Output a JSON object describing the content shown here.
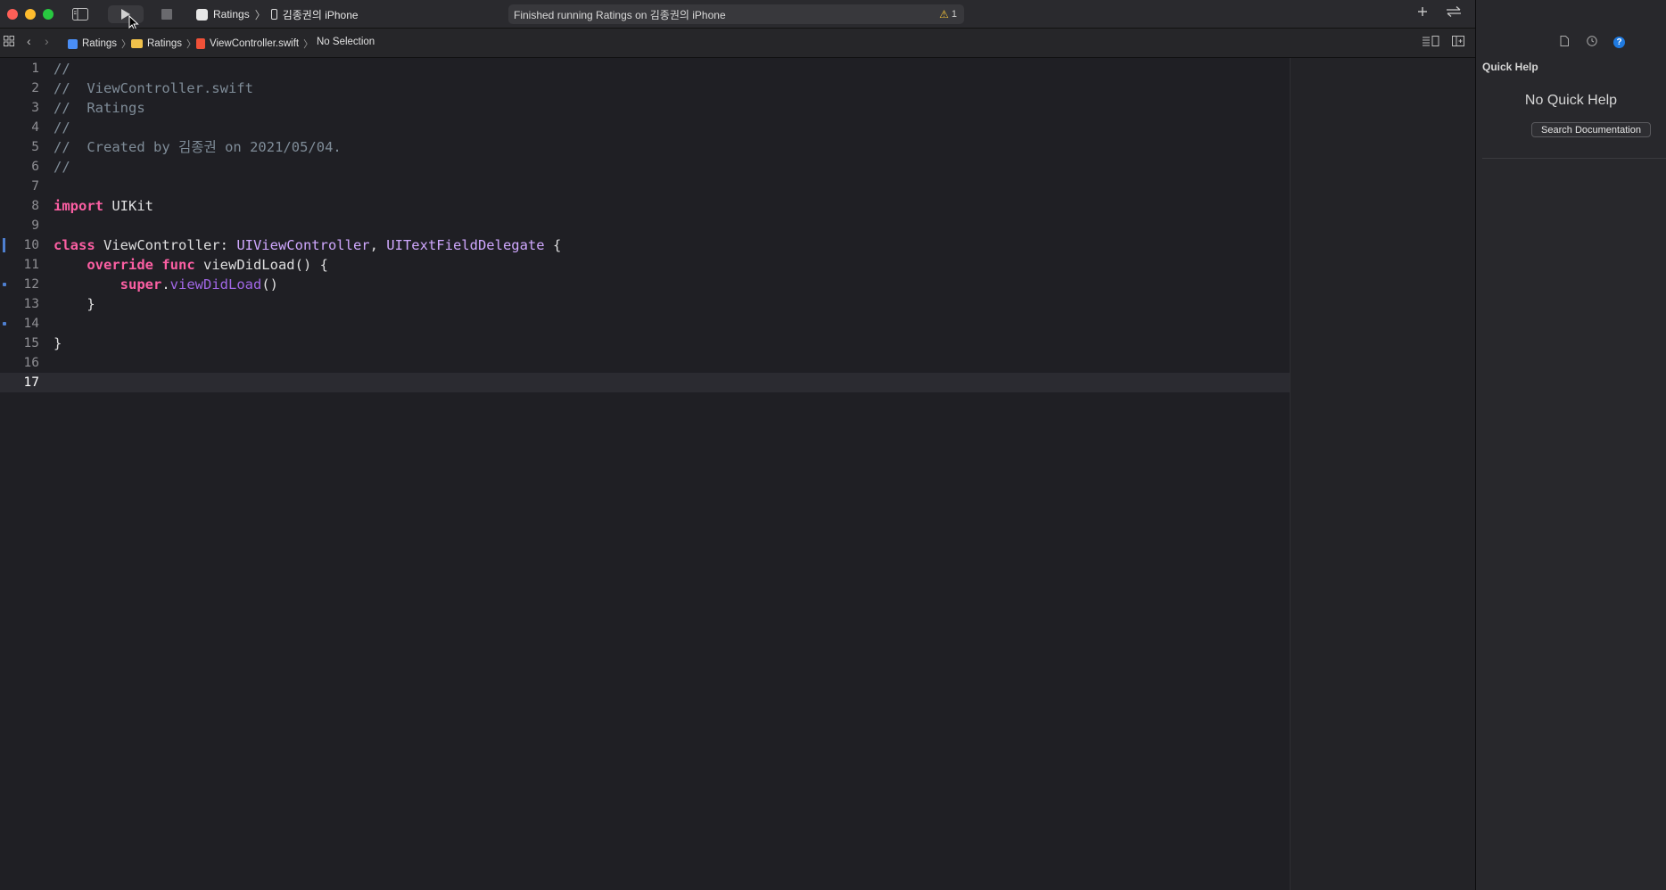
{
  "toolbar": {
    "scheme_target": "Ratings",
    "scheme_device": "김종권의 iPhone",
    "activity_status": "Finished running Ratings on 김종권의 iPhone",
    "warning_count": "1",
    "icons": [
      "sidebar-toggle-icon",
      "play-icon",
      "stop-icon",
      "plus-icon",
      "swap-icon"
    ]
  },
  "jumpbar": {
    "crumbs": [
      "Ratings",
      "Ratings",
      "ViewController.swift",
      "No Selection"
    ]
  },
  "editor": {
    "current_line": 17,
    "lines": [
      {
        "n": "1",
        "tokens": [
          {
            "t": "//",
            "c": "comment"
          }
        ]
      },
      {
        "n": "2",
        "tokens": [
          {
            "t": "//  ViewController.swift",
            "c": "comment"
          }
        ]
      },
      {
        "n": "3",
        "tokens": [
          {
            "t": "//  Ratings",
            "c": "comment"
          }
        ]
      },
      {
        "n": "4",
        "tokens": [
          {
            "t": "//",
            "c": "comment"
          }
        ]
      },
      {
        "n": "5",
        "tokens": [
          {
            "t": "//  Created by 김종권 on 2021/05/04.",
            "c": "comment"
          }
        ]
      },
      {
        "n": "6",
        "tokens": [
          {
            "t": "//",
            "c": "comment"
          }
        ]
      },
      {
        "n": "7",
        "tokens": []
      },
      {
        "n": "8",
        "tokens": [
          {
            "t": "import",
            "c": "keyword"
          },
          {
            "t": " UIKit",
            "c": "plain"
          }
        ]
      },
      {
        "n": "9",
        "tokens": []
      },
      {
        "n": "10",
        "tokens": [
          {
            "t": "class",
            "c": "keyword"
          },
          {
            "t": " ViewController: ",
            "c": "plain"
          },
          {
            "t": "UIViewController",
            "c": "type"
          },
          {
            "t": ", ",
            "c": "plain"
          },
          {
            "t": "UITextFieldDelegate",
            "c": "type"
          },
          {
            "t": " {",
            "c": "plain"
          }
        ]
      },
      {
        "n": "11",
        "tokens": [
          {
            "t": "    ",
            "c": "plain"
          },
          {
            "t": "override",
            "c": "keyword"
          },
          {
            "t": " ",
            "c": "plain"
          },
          {
            "t": "func",
            "c": "keyword"
          },
          {
            "t": " viewDidLoad() {",
            "c": "plain"
          }
        ]
      },
      {
        "n": "12",
        "tokens": [
          {
            "t": "        ",
            "c": "plain"
          },
          {
            "t": "super",
            "c": "keyword"
          },
          {
            "t": ".",
            "c": "plain"
          },
          {
            "t": "viewDidLoad",
            "c": "func"
          },
          {
            "t": "()",
            "c": "plain"
          }
        ]
      },
      {
        "n": "13",
        "tokens": [
          {
            "t": "    }",
            "c": "plain"
          }
        ]
      },
      {
        "n": "14",
        "tokens": []
      },
      {
        "n": "15",
        "tokens": [
          {
            "t": "}",
            "c": "plain"
          }
        ]
      },
      {
        "n": "16",
        "tokens": []
      },
      {
        "n": "17",
        "tokens": []
      }
    ]
  },
  "inspector": {
    "title": "Quick Help",
    "empty_message": "No Quick Help",
    "search_button": "Search Documentation",
    "help_tab_glyph": "?"
  },
  "colors": {
    "keyword": "#fc5fa3",
    "comment": "#7f8c98",
    "type": "#d0a8ff",
    "func": "#a167e6",
    "accent": "#1f7ae0"
  }
}
